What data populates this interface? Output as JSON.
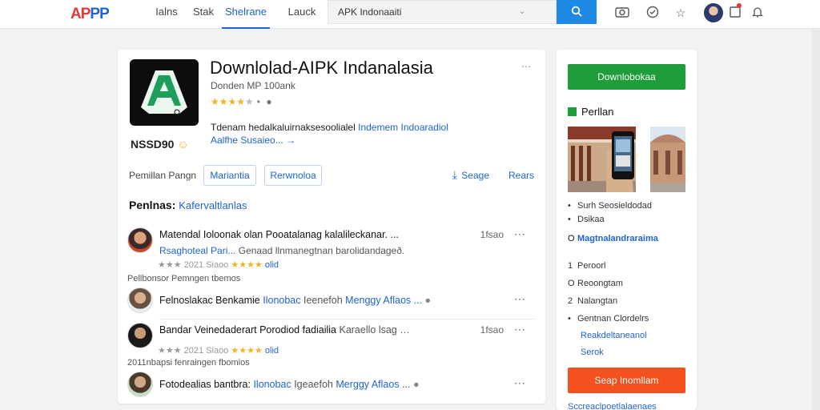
{
  "header": {
    "logo": "APPP",
    "nav": [
      "Ialns",
      "Stak",
      "Shelrane",
      "Lauck"
    ],
    "search_value": "APK Indonaaiti",
    "search_button_icon": "search-icon",
    "icons": [
      "camera-icon",
      "shield-icon",
      "star-icon",
      "avatar",
      "notification-icon",
      "bell-icon"
    ]
  },
  "app": {
    "title": "Downlolad-AIPK Indanalasia",
    "developer": "Donden MP 100ank",
    "rating_stars": 3.5,
    "brand": "NSSD90",
    "description_text": "Tdenam hedalkaluirnaksesoolialel",
    "description_link1": "Indemem Indoaradiol",
    "description_link2": "Aalfhe Susaieo... →",
    "row_label": "Pemillan Pangn",
    "btn1": "Mariantia",
    "btn2": "Rerwnoloa",
    "share": "Seage",
    "report": "Rears"
  },
  "reviews": {
    "heading": "Penlnas:",
    "heading_link": "Kafervaltlanlas",
    "items": [
      {
        "title": "Matendal Ioloonak olan Pooatalanag kalalileckanar. ...",
        "sub_link": "Rsaghoteal Pari...",
        "sub_text": "Genaad llnmanegtnan barolidandageð.",
        "time": "1fsao",
        "stars_prefix": "★★★  2021 Siaoo",
        "stars_gold": "★★★★",
        "stars_suffix": "olid",
        "note": "Pellbonsor Pemngen tbemos"
      },
      {
        "title": "Felnoslakac Benkamie",
        "sub_link": "Ilonobac",
        "sub_text": "Ieenefoh",
        "sub_link2": "Menggy Aflaos ...",
        "time": "",
        "stars_prefix": "",
        "stars_gold": "",
        "stars_suffix": "",
        "note": ""
      },
      {
        "title": "Bandar Veinedaderart Porodiod fadiailia",
        "sub_link": "",
        "sub_text": "Karaello lsag …",
        "time": "1fsao",
        "stars_prefix": "★★★  2021 Siaoo",
        "stars_gold": "★★★★",
        "stars_suffix": "olid",
        "note": "2011nbapsi fenraingen fbomios"
      },
      {
        "title": "Fotodealias bantbra:",
        "sub_link": "Ilonobac",
        "sub_text": "Igeaefoh",
        "sub_link2": "Merggy Aflaos ...",
        "time": "",
        "stars_prefix": "",
        "stars_gold": "",
        "stars_suffix": "",
        "note": ""
      }
    ]
  },
  "sidebar": {
    "download_button": "Downlobokaa",
    "heading": "Perllan",
    "list1": [
      "Surh  Seosieldodad",
      "Dsikaa"
    ],
    "link1": "Magtnalandraraima",
    "list2": [
      {
        "mark": "1",
        "text": "Peroorl"
      },
      {
        "mark": "O",
        "text": "Reoongtam"
      },
      {
        "mark": "2",
        "text": "Nalangtan"
      },
      {
        "mark": "•",
        "text": "Gentnan Clordelrs"
      }
    ],
    "link2": "Reakdeltaneanol",
    "link3": "Serok",
    "orange_button": "Seap Inomllam",
    "footer": "Sccreaclpoetlalaenaes"
  },
  "colors": {
    "accent": "#1e63d6",
    "download_green": "#1f9d3a",
    "orange": "#f4511e",
    "star": "#f3b320"
  }
}
